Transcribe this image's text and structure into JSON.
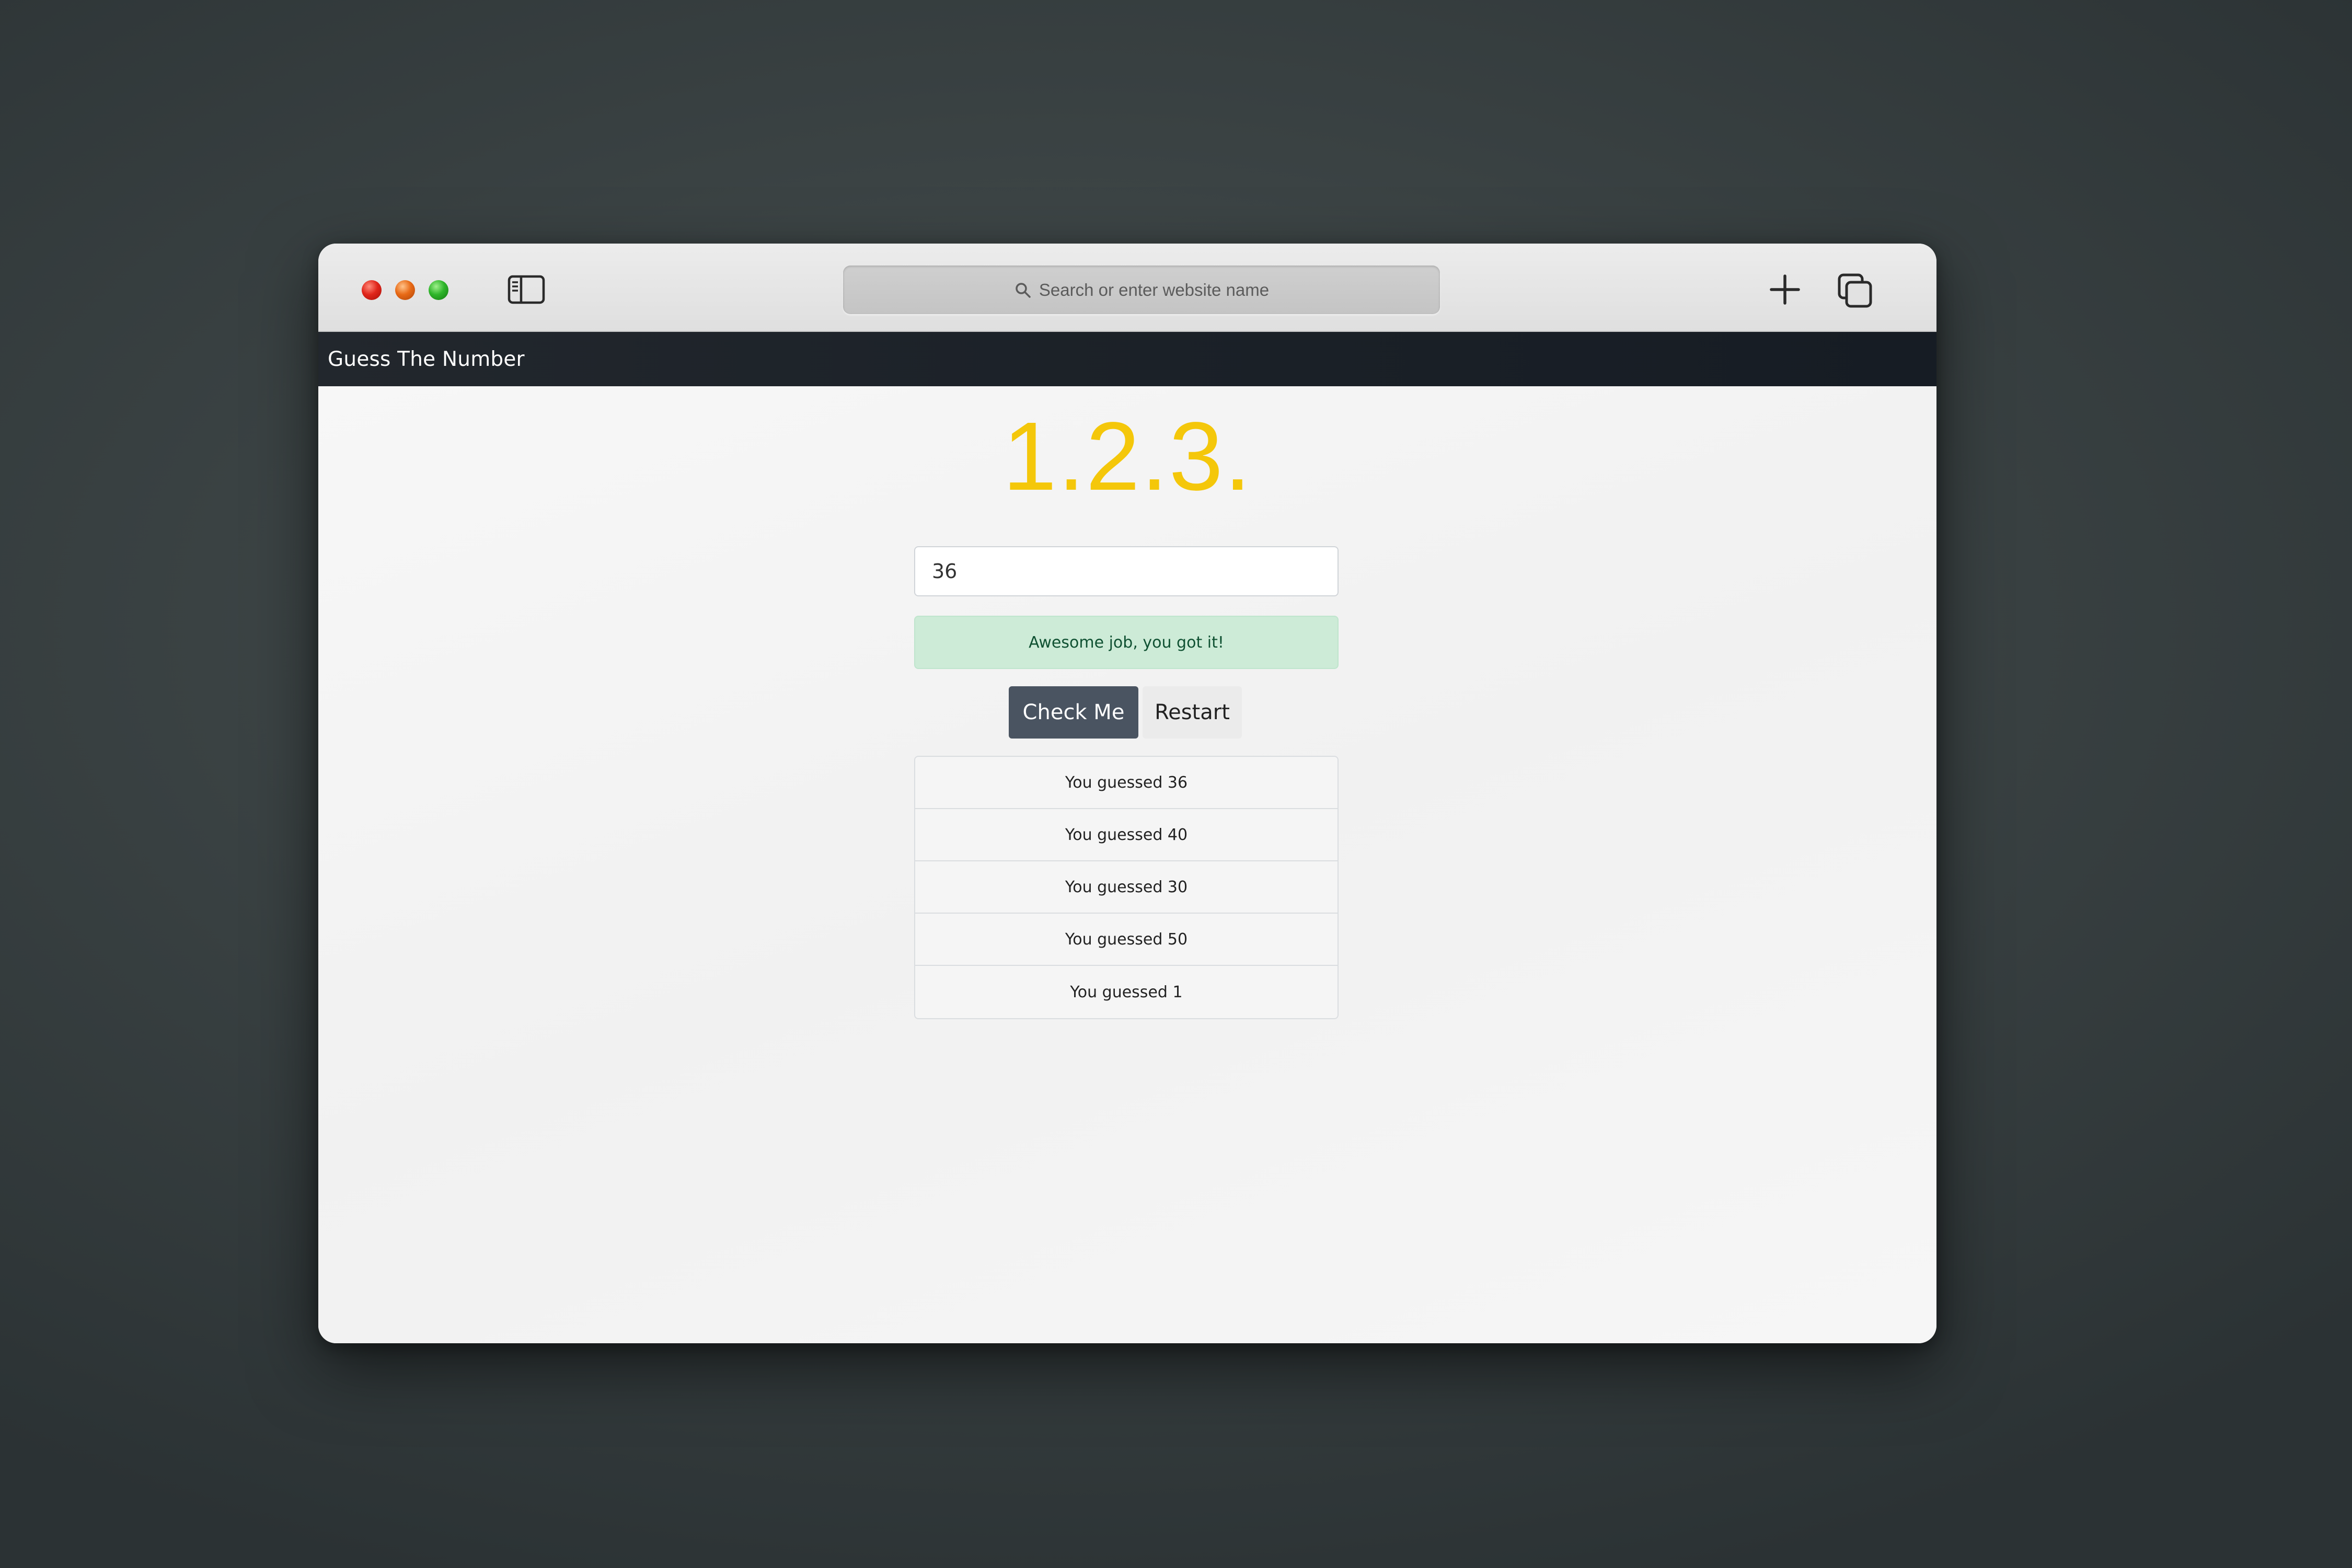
{
  "browser": {
    "address_placeholder": "Search or enter website name",
    "icons": [
      "close-button",
      "minimize-button",
      "zoom-button",
      "sidebar-icon",
      "back-icon",
      "forward-icon",
      "search-icon",
      "new-tab-icon",
      "tabs-overview-icon"
    ]
  },
  "app": {
    "title": "Guess The Number",
    "secret_display": "1.2.3.",
    "input_value": "36",
    "alert_message": "Awesome job, you got it!",
    "check_button": "Check Me",
    "restart_button": "Restart",
    "guesses": [
      "You guessed 36",
      "You guessed 40",
      "You guessed 30",
      "You guessed 50",
      "You guessed 1"
    ]
  },
  "colors": {
    "accent_number": "#f4c70a",
    "navbar": "#1a2027",
    "check_button": "#4a5461",
    "alert_bg": "#cdebd7",
    "alert_text": "#0f5132"
  }
}
